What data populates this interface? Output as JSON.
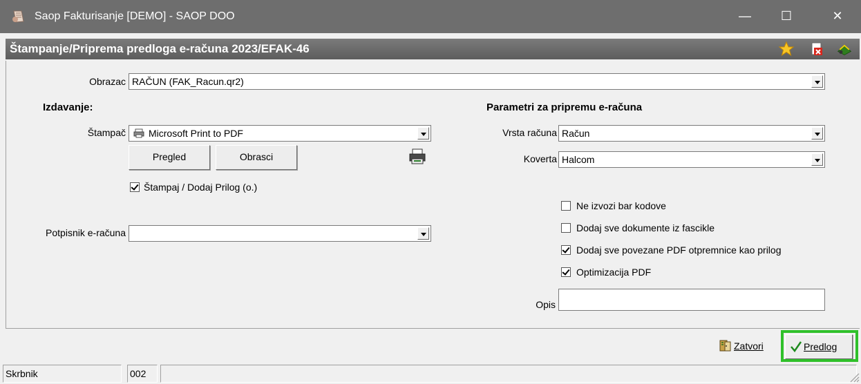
{
  "window": {
    "title": "Saop Fakturisanje [DEMO] - SAOP DOO",
    "minimize": "—",
    "maximize": "☐",
    "close": "✕"
  },
  "header": {
    "title": "Štampanje/Priprema predloga e-računa 2023/EFAK-46",
    "icons": [
      "star-icon",
      "pdf-delete-icon",
      "books-icon"
    ]
  },
  "form": {
    "obrazac_label": "Obrazac",
    "obrazac_value": "RAČUN  (FAK_Racun.qr2)",
    "izdavanje_heading": "Izdavanje:",
    "stampac_label": "Štampač",
    "stampac_value": "Microsoft Print to PDF",
    "pregled_button": "Pregled",
    "obrasci_button": "Obrasci",
    "stampaj_checkbox": "Štampaj / Dodaj Prilog (o.)",
    "stampaj_checked": true,
    "potpisnik_label": "Potpisnik e-računa",
    "potpisnik_value": "",
    "params_heading": "Parametri za pripremu e-računa",
    "vrsta_label": "Vrsta računa",
    "vrsta_value": "Račun",
    "koverta_label": "Koverta",
    "koverta_value": "Halcom",
    "options": [
      {
        "label": "Ne izvozi bar kodove",
        "checked": false
      },
      {
        "label": "Dodaj sve dokumente iz fascikle",
        "checked": false
      },
      {
        "label": "Dodaj sve povezane PDF otpremnice kao prilog",
        "checked": true
      },
      {
        "label": "Optimizacija PDF",
        "checked": true
      }
    ],
    "opis_label": "Opis",
    "opis_value": ""
  },
  "actions": {
    "zatvori": "Zatvori",
    "predlog": "Predlog",
    "highlight_color": "#2fc02a"
  },
  "statusbar": {
    "user": "Skrbnik",
    "code": "002"
  }
}
